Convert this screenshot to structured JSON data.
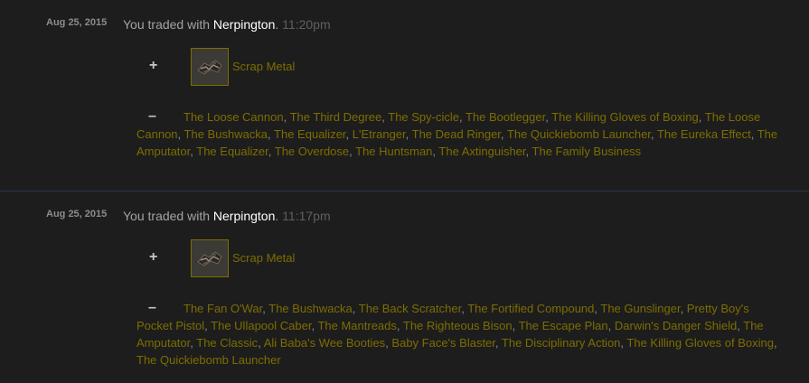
{
  "trades": [
    {
      "date": "Aug 25, 2015",
      "prefix": "You traded with",
      "partner": "Nerpington",
      "punct": ".",
      "time": "11:20pm",
      "plus_symbol": "+",
      "minus_symbol": "–",
      "received": {
        "name": "Scrap Metal",
        "icon": "scrap-metal-icon"
      },
      "lost": [
        "The Loose Cannon",
        "The Third Degree",
        "The Spy-cicle",
        "The Bootlegger",
        "The Killing Gloves of Boxing",
        "The Loose Cannon",
        "The Bushwacka",
        "The Equalizer",
        "L'Etranger",
        "The Dead Ringer",
        "The Quickiebomb Launcher",
        "The Eureka Effect",
        "The Amputator",
        "The Equalizer",
        "The Overdose",
        "The Huntsman",
        "The Axtinguisher",
        "The Family Business"
      ]
    },
    {
      "date": "Aug 25, 2015",
      "prefix": "You traded with",
      "partner": "Nerpington",
      "punct": ".",
      "time": "11:17pm",
      "plus_symbol": "+",
      "minus_symbol": "–",
      "received": {
        "name": "Scrap Metal",
        "icon": "scrap-metal-icon"
      },
      "lost": [
        "The Fan O'War",
        "The Bushwacka",
        "The Back Scratcher",
        "The Fortified Compound",
        "The Gunslinger",
        "Pretty Boy's Pocket Pistol",
        "The Ullapool Caber",
        "The Mantreads",
        "The Righteous Bison",
        "The Escape Plan",
        "Darwin's Danger Shield",
        "The Amputator",
        "The Classic",
        "Ali Baba's Wee Booties",
        "Baby Face's Blaster",
        "The Disciplinary Action",
        "The Killing Gloves of Boxing",
        "The Quickiebomb Launcher"
      ]
    }
  ],
  "colors": {
    "item_link": "#7d6d00",
    "partner": "#ffffff",
    "divider": "#2b3645"
  }
}
